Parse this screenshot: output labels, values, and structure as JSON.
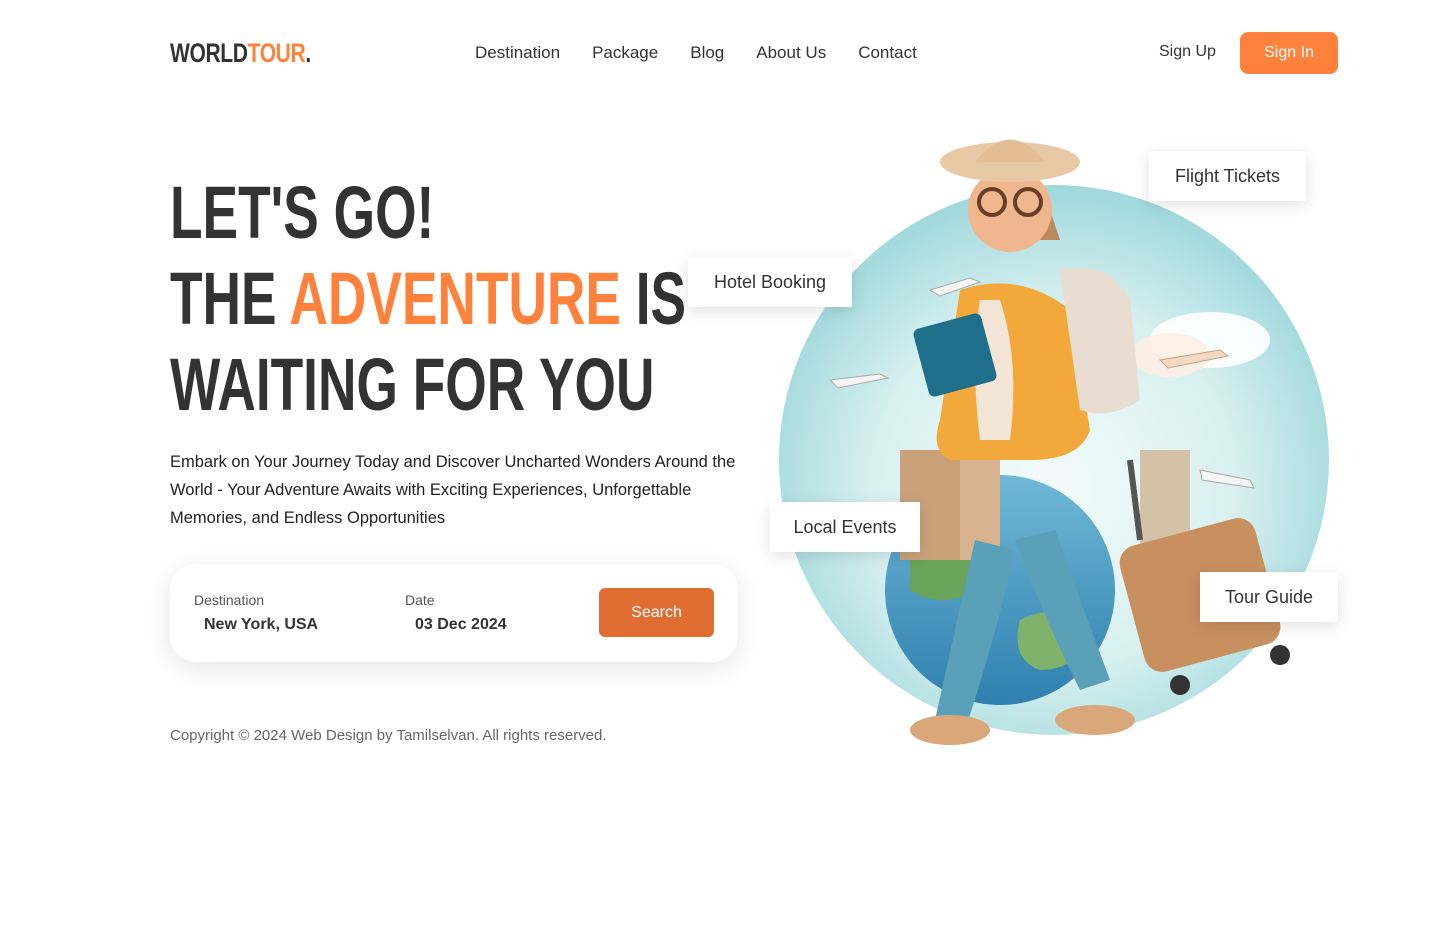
{
  "header": {
    "logo_main": "WORLD",
    "logo_accent": "TOUR",
    "logo_dot": ".",
    "nav": [
      "Destination",
      "Package",
      "Blog",
      "About Us",
      "Contact"
    ],
    "signup_label": "Sign Up",
    "signin_label": "Sign In"
  },
  "hero": {
    "line1": "LET'S GO!",
    "line2_start": "THE ",
    "line2_accent": "ADVENTURE",
    "line2_end": " IS",
    "line3": "WAITING FOR YOU",
    "description": "Embark on Your Journey Today and Discover Uncharted Wonders Around the World - Your Adventure Awaits with Exciting Experiences, Unforgettable Memories, and Endless Opportunities"
  },
  "search": {
    "destination_label": "Destination",
    "destination_value": "New York, USA",
    "date_label": "Date",
    "date_value": "03 Dec 2024",
    "button_label": "Search"
  },
  "footer": {
    "copyright": "Copyright © 2024 Web Design by Tamilselvan. All rights reserved."
  },
  "tags": {
    "flight": "Flight Tickets",
    "hotel": "Hotel Booking",
    "events": "Local Events",
    "guide": "Tour Guide"
  },
  "colors": {
    "accent": "#ff823c",
    "search_button": "#e06e32",
    "text_dark": "#333333"
  }
}
